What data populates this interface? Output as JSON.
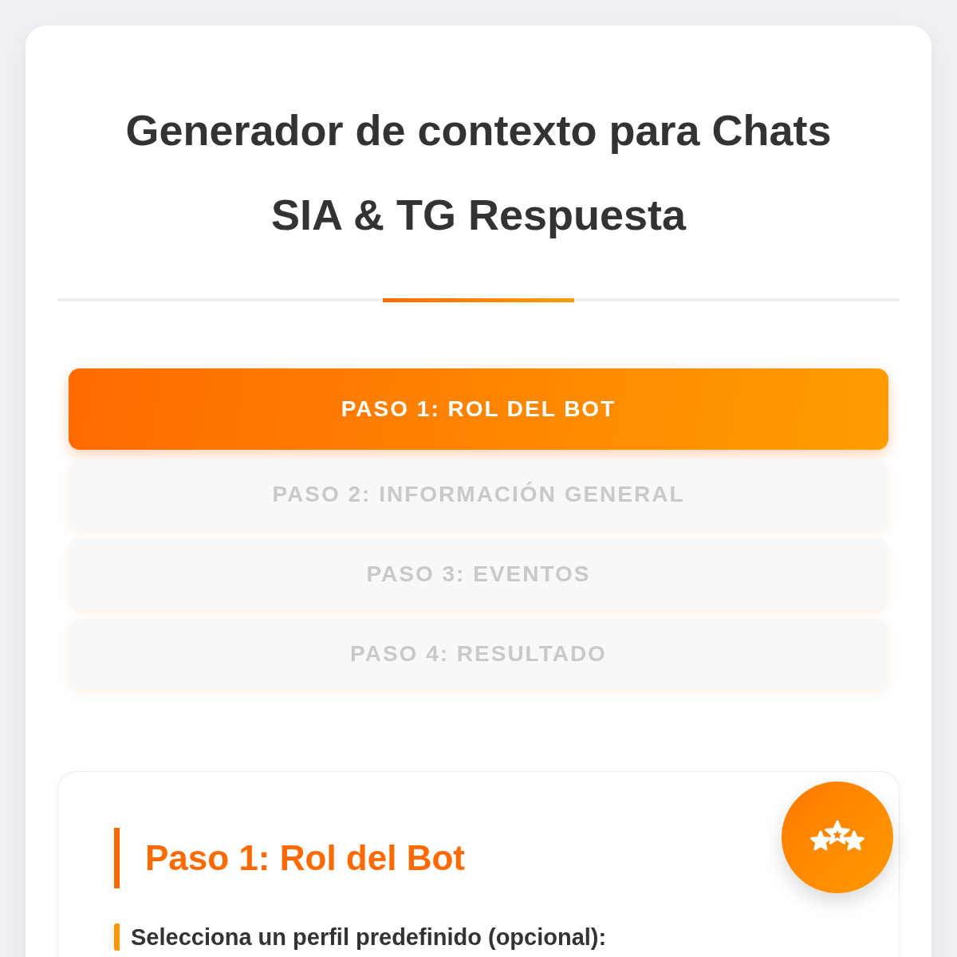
{
  "title": "Generador de contexto para Chats SIA & TG Respuesta",
  "steps": [
    {
      "label": "PASO 1: ROL DEL BOT",
      "selected": true
    },
    {
      "label": "PASO 2: INFORMACIÓN GENERAL",
      "selected": false
    },
    {
      "label": "PASO 3: EVENTOS",
      "selected": false
    },
    {
      "label": "PASO 4: RESULTADO",
      "selected": false
    }
  ],
  "section": {
    "heading": "Paso 1: Rol del Bot",
    "field_label": "Selecciona un perfil predefinido (opcional):"
  }
}
